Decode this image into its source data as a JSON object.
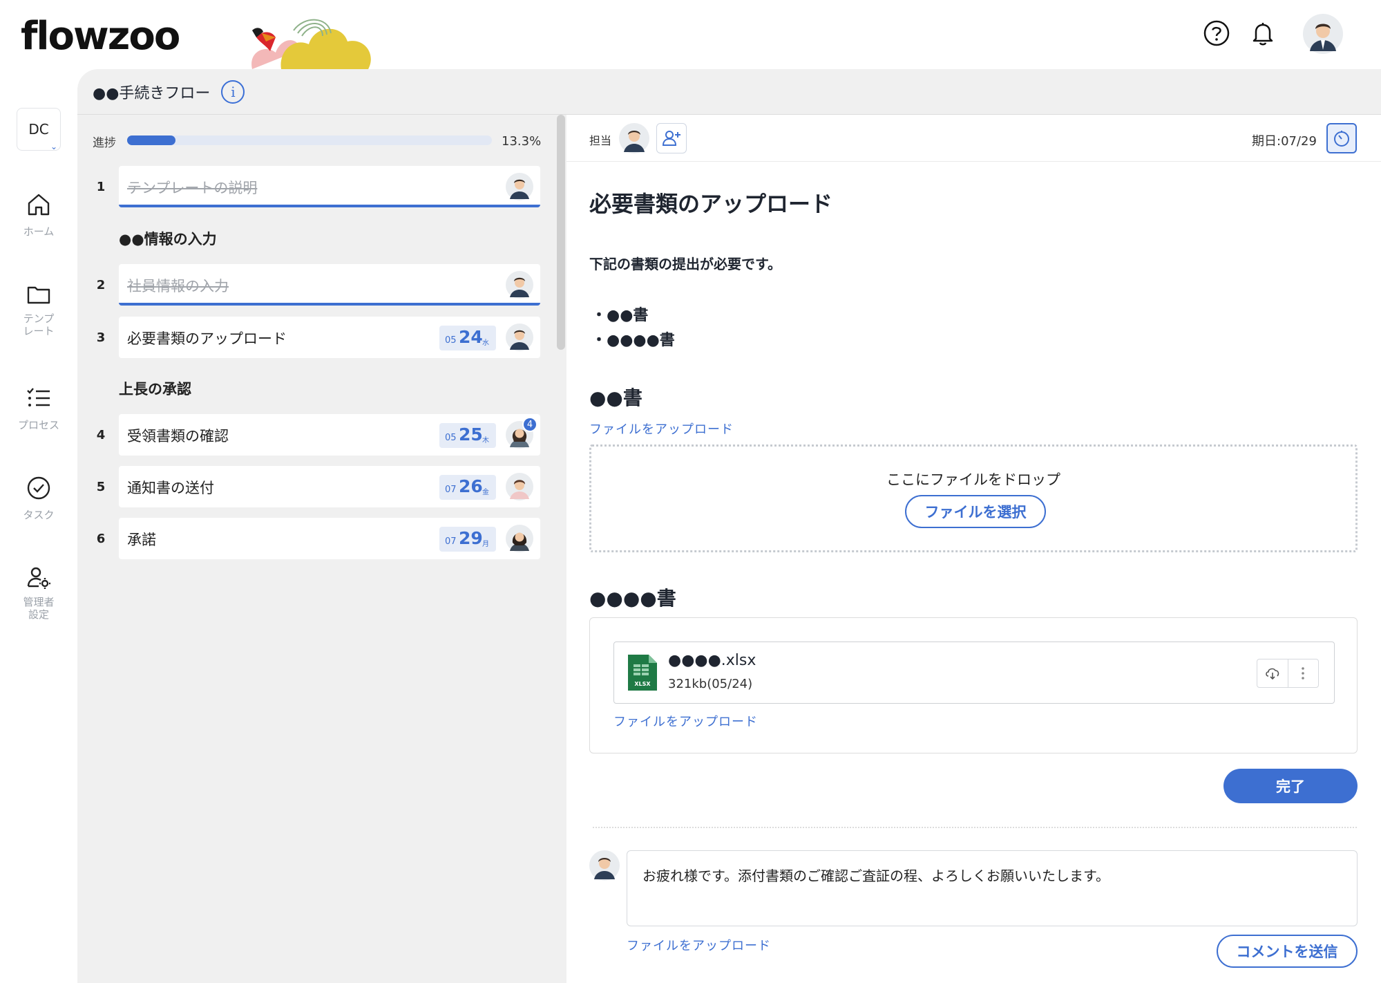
{
  "app": {
    "logo": "flowzoo"
  },
  "workspace": {
    "code": "DC"
  },
  "nav": {
    "home": "ホーム",
    "template_line1": "テンプ",
    "template_line2": "レート",
    "process": "プロセス",
    "task": "タスク",
    "admin_line1": "管理者",
    "admin_line2": "設定"
  },
  "flow": {
    "title": "●●手続きフロー"
  },
  "progress": {
    "label": "進捗",
    "value": "13.3%",
    "fraction": 0.133
  },
  "steps": {
    "s1": {
      "num": "1",
      "title": "テンプレートの説明"
    },
    "section1": "●●情報の入力",
    "s2": {
      "num": "2",
      "title": "社員情報の入力"
    },
    "s3": {
      "num": "3",
      "title": "必要書類のアップロード",
      "mm": "05",
      "dd": "24",
      "dw": "水"
    },
    "section2": "上長の承認",
    "s4": {
      "num": "4",
      "title": "受領書類の確認",
      "mm": "05",
      "dd": "25",
      "dw": "木",
      "badge": "4"
    },
    "s5": {
      "num": "5",
      "title": "通知書の送付",
      "mm": "07",
      "dd": "26",
      "dw": "金"
    },
    "s6": {
      "num": "6",
      "title": "承諾",
      "mm": "07",
      "dd": "29",
      "dw": "月"
    }
  },
  "task": {
    "assignee_label": "担当",
    "due": "期日:07/29",
    "title": "必要書類のアップロード",
    "description": "下記の書類の提出が必要です。",
    "bullet1": "・●●書",
    "bullet2": "・●●●●書",
    "doc1_heading": "●●書",
    "upload_link": "ファイルをアップロード",
    "drop_text": "ここにファイルをドロップ",
    "select_file": "ファイルを選択",
    "doc2_heading": "●●●●書",
    "file_name": "●●●●.xlsx",
    "file_meta": "321kb(05/24)",
    "file_icon_label": "XLSX",
    "complete": "完了"
  },
  "comment": {
    "text": "お疲れ様です。添付書類のご確認ご査証の程、よろしくお願いいたします。",
    "upload_link": "ファイルをアップロード",
    "send": "コメントを送信"
  },
  "colors": {
    "accent": "#3d6fd1",
    "bg_main": "#f0f0f0"
  }
}
